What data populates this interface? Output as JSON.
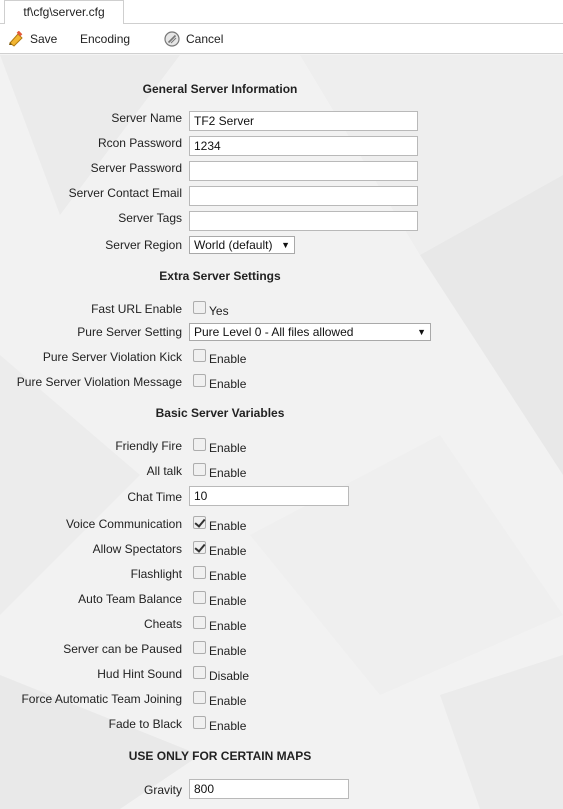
{
  "tab": {
    "label": "tf\\cfg\\server.cfg"
  },
  "toolbar": {
    "save": "Save",
    "encoding": "Encoding",
    "cancel": "Cancel"
  },
  "sections": {
    "general": "General Server Information",
    "extra": "Extra Server Settings",
    "basic": "Basic Server Variables",
    "maps": "USE ONLY FOR CERTAIN MAPS"
  },
  "general": {
    "server_name": {
      "label": "Server Name",
      "value": "TF2 Server"
    },
    "rcon_password": {
      "label": "Rcon Password",
      "value": "1234"
    },
    "server_password": {
      "label": "Server Password",
      "value": ""
    },
    "contact_email": {
      "label": "Server Contact Email",
      "value": ""
    },
    "server_tags": {
      "label": "Server Tags",
      "value": ""
    },
    "server_region": {
      "label": "Server Region",
      "value": "World (default)"
    }
  },
  "extra": {
    "fast_url": {
      "label": "Fast URL Enable",
      "option": "Yes",
      "checked": false
    },
    "pure_setting": {
      "label": "Pure Server Setting",
      "value": "Pure Level 0 - All files allowed"
    },
    "pure_kick": {
      "label": "Pure Server Violation Kick",
      "option": "Enable",
      "checked": false
    },
    "pure_message": {
      "label": "Pure Server Violation Message",
      "option": "Enable",
      "checked": false
    }
  },
  "basic": {
    "friendly_fire": {
      "label": "Friendly Fire",
      "option": "Enable",
      "checked": false
    },
    "all_talk": {
      "label": "All talk",
      "option": "Enable",
      "checked": false
    },
    "chat_time": {
      "label": "Chat Time",
      "value": "10"
    },
    "voice": {
      "label": "Voice Communication",
      "option": "Enable",
      "checked": true
    },
    "spectators": {
      "label": "Allow Spectators",
      "option": "Enable",
      "checked": true
    },
    "flashlight": {
      "label": "Flashlight",
      "option": "Enable",
      "checked": false
    },
    "auto_balance": {
      "label": "Auto Team Balance",
      "option": "Enable",
      "checked": false
    },
    "cheats": {
      "label": "Cheats",
      "option": "Enable",
      "checked": false
    },
    "pausable": {
      "label": "Server can be Paused",
      "option": "Enable",
      "checked": false
    },
    "hud_hint": {
      "label": "Hud Hint Sound",
      "option": "Disable",
      "checked": false
    },
    "force_join": {
      "label": "Force Automatic Team Joining",
      "option": "Enable",
      "checked": false
    },
    "fade_black": {
      "label": "Fade to Black",
      "option": "Enable",
      "checked": false
    }
  },
  "maps": {
    "gravity": {
      "label": "Gravity",
      "value": "800"
    }
  }
}
